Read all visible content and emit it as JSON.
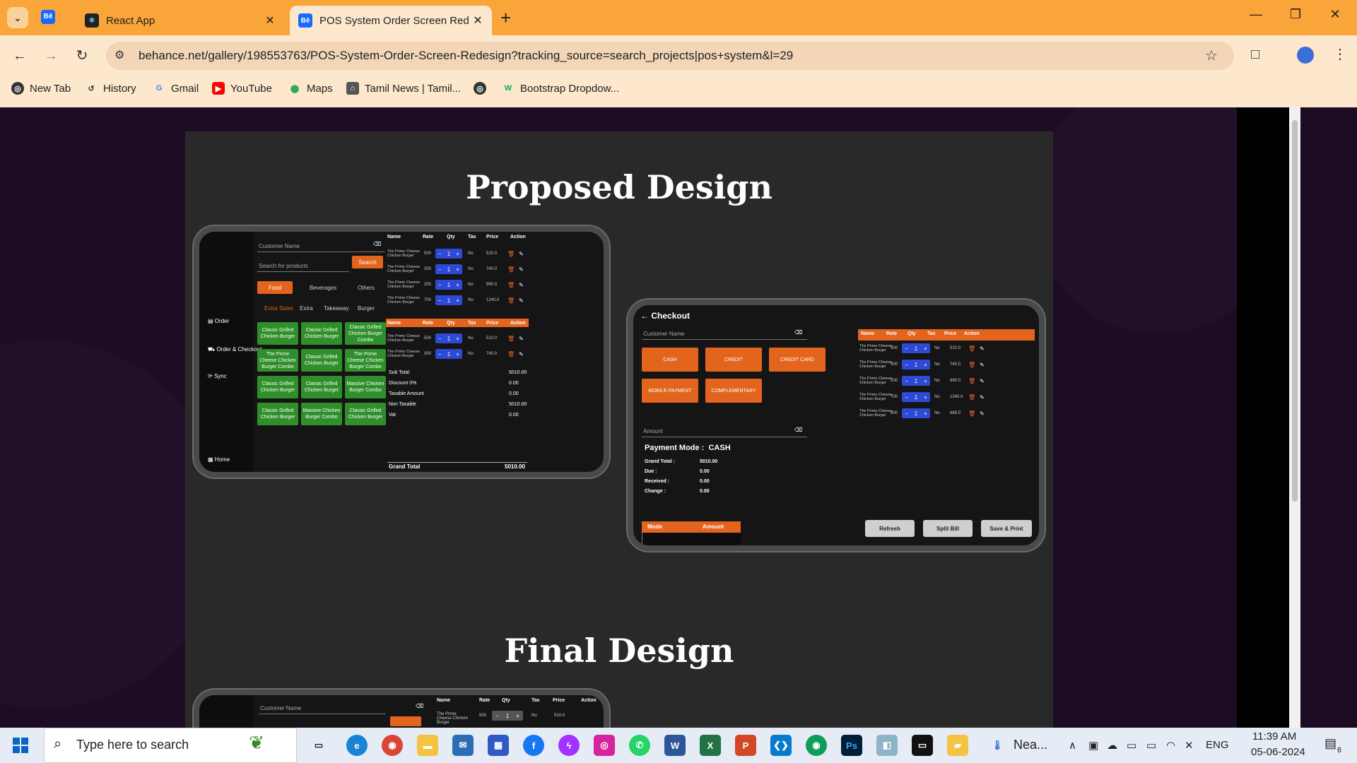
{
  "browser": {
    "tabs": [
      {
        "title": "React App",
        "active": false
      },
      {
        "title": "POS System Order Screen Rede",
        "active": true
      }
    ],
    "new_tab": "+",
    "url": "behance.net/gallery/198553763/POS-System-Order-Screen-Redesign?tracking_source=search_projects|pos+system&l=29",
    "bookmarks": [
      "New Tab",
      "History",
      "Gmail",
      "YouTube",
      "Maps",
      "Tamil News | Tamil...",
      "",
      "Bootstrap Dropdow..."
    ]
  },
  "page": {
    "heading_proposed": "Proposed Design",
    "heading_final": "Final Design"
  },
  "pos": {
    "customer_placeholder": "Customer Name",
    "search_placeholder": "Search for products",
    "search_btn": "Search",
    "categories": [
      "Food",
      "Beverages",
      "Others"
    ],
    "subtabs": [
      "Extra Sides",
      "Extra",
      "Takeaway",
      "Burger"
    ],
    "sidebar": [
      "Order",
      "Order & Checkout",
      "Sync",
      "Home"
    ],
    "products": [
      "Classic Grilled Chicken Burger",
      "Classic Grilled Chicken Burger",
      "Classic Grilled Chicken Burger Combo",
      "The Prime Cheese Chicken Burger Combo",
      "Classic Grilled Chicken Burger",
      "The Prime Cheese Chicken Burger Combo",
      "Classic Grilled Chicken Burger",
      "Classic Grilled Chicken Burger",
      "Massive Chicken Burger Combo",
      "Classic Grilled Chicken Burger",
      "Massive Chicken Burger Combo",
      "Classic Grilled Chicken Burger"
    ],
    "table_headers": [
      "Name",
      "Rate",
      "Qty",
      "Tax",
      "Price",
      "Action"
    ],
    "order_rows": [
      {
        "name": "The Prime Cheese Chicken Burger",
        "rate": "500",
        "qty": "1",
        "tax": "No",
        "price": "510.0"
      },
      {
        "name": "The Prime Cheese Chicken Burger",
        "rate": "300",
        "qty": "1",
        "tax": "No",
        "price": "740.0"
      },
      {
        "name": "The Prime Cheese Chicken Burger",
        "rate": "200",
        "qty": "1",
        "tax": "No",
        "price": "990.0"
      },
      {
        "name": "The Prime Cheese Chicken Burger",
        "rate": "700",
        "qty": "1",
        "tax": "No",
        "price": "1240.0"
      }
    ],
    "order_rows_2": [
      {
        "name": "The Prime Cheese Chicken Burger",
        "rate": "500",
        "qty": "1",
        "tax": "No",
        "price": "510.0"
      },
      {
        "name": "The Prime Cheese Chicken Burger",
        "rate": "300",
        "qty": "1",
        "tax": "No",
        "price": "740.0"
      }
    ],
    "summary": [
      {
        "label": "Sub Total",
        "value": "5010.00"
      },
      {
        "label": "Discount   0%",
        "value": "0.00"
      },
      {
        "label": "Taxable Amount",
        "value": "0.00"
      },
      {
        "label": "Non Taxable",
        "value": "5010.00"
      },
      {
        "label": "Vat",
        "value": "0.00"
      }
    ],
    "grand_total_label": "Grand Total",
    "grand_total": "5010.00"
  },
  "checkout": {
    "title": "Checkout",
    "customer_placeholder": "Customer Name",
    "pay_buttons": [
      "CASH",
      "CREDIT",
      "CREDIT CARD",
      "MOBILE PAYMENT",
      "COMPLEMENTARY"
    ],
    "amount_placeholder": "Amount",
    "payment_mode_label": "Payment Mode :",
    "payment_mode": "CASH",
    "totals": [
      {
        "label": "Grand Total :",
        "value": "5010.00"
      },
      {
        "label": "Due :",
        "value": "0.00"
      },
      {
        "label": "Received :",
        "value": "0.00"
      },
      {
        "label": "Change :",
        "value": "0.00"
      }
    ],
    "mode_headers": [
      "Mode",
      "Amount"
    ],
    "rows": [
      {
        "name": "The Prime Cheese Chicken Burger",
        "rate": "500",
        "qty": "1",
        "tax": "No",
        "price": "510.0"
      },
      {
        "name": "The Prime Cheese Chicken Burger",
        "rate": "300",
        "qty": "1",
        "tax": "No",
        "price": "740.0"
      },
      {
        "name": "The Prime Cheese Chicken Burger",
        "rate": "200",
        "qty": "1",
        "tax": "No",
        "price": "990.0"
      },
      {
        "name": "The Prime Cheese Chicken Burger",
        "rate": "700",
        "qty": "1",
        "tax": "No",
        "price": "1240.0"
      },
      {
        "name": "The Prime Cheese Chicken Burger",
        "rate": "800",
        "qty": "1",
        "tax": "No",
        "price": "669.0"
      }
    ],
    "actions": [
      "Refresh",
      "Split Bill",
      "Save & Print"
    ]
  },
  "final_preview": {
    "customer_placeholder": "Customer Name",
    "row": {
      "name": "The Prime Cheese Chicken Burger",
      "rate": "500",
      "qty": "1",
      "tax": "No",
      "price": "510.0"
    }
  },
  "taskbar": {
    "search_placeholder": "Type here to search",
    "weather": "Nea...",
    "lang": "ENG",
    "time": "11:39 AM",
    "date": "05-06-2024",
    "notifications": "6"
  },
  "colors": {
    "accent": "#e2641d",
    "green": "#2f8f2a",
    "blue": "#2d49d6",
    "chrome": "#f9a53a"
  }
}
